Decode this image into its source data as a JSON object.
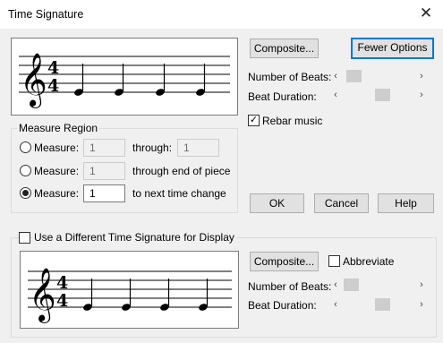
{
  "window": {
    "title": "Time Signature",
    "close_glyph": "✕"
  },
  "top_section": {
    "staff": {
      "time_top": "4",
      "time_bottom": "4"
    },
    "composite_label": "Composite...",
    "fewer_options_label": "Fewer Options",
    "number_of_beats_label": "Number of Beats:",
    "beat_duration_label": "Beat Duration:",
    "rebar_label": "Rebar music",
    "rebar_checked": true,
    "number_of_beats_position": 0.15,
    "beat_duration_position": 0.55
  },
  "measure_region": {
    "legend": "Measure Region",
    "row1": {
      "label": "Measure:",
      "from": "1",
      "through_label": "through:",
      "to": "1",
      "selected": false
    },
    "row2": {
      "label": "Measure:",
      "from": "1",
      "suffix": "through end of piece",
      "selected": false
    },
    "row3": {
      "label": "Measure:",
      "from": "1",
      "suffix": "to next time change",
      "selected": true
    }
  },
  "actions": {
    "ok": "OK",
    "cancel": "Cancel",
    "help": "Help"
  },
  "display_section": {
    "checkbox_label": "Use a Different Time Signature for Display",
    "checked": false,
    "staff": {
      "time_top": "4",
      "time_bottom": "4"
    },
    "composite_label": "Composite...",
    "abbreviate_label": "Abbreviate",
    "abbreviate_checked": false,
    "number_of_beats_label": "Number of Beats:",
    "beat_duration_label": "Beat Duration:",
    "number_of_beats_position": 0.1,
    "beat_duration_position": 0.55
  },
  "icons": {
    "scroll_left": "‹",
    "scroll_right": "›",
    "check": "✓"
  }
}
